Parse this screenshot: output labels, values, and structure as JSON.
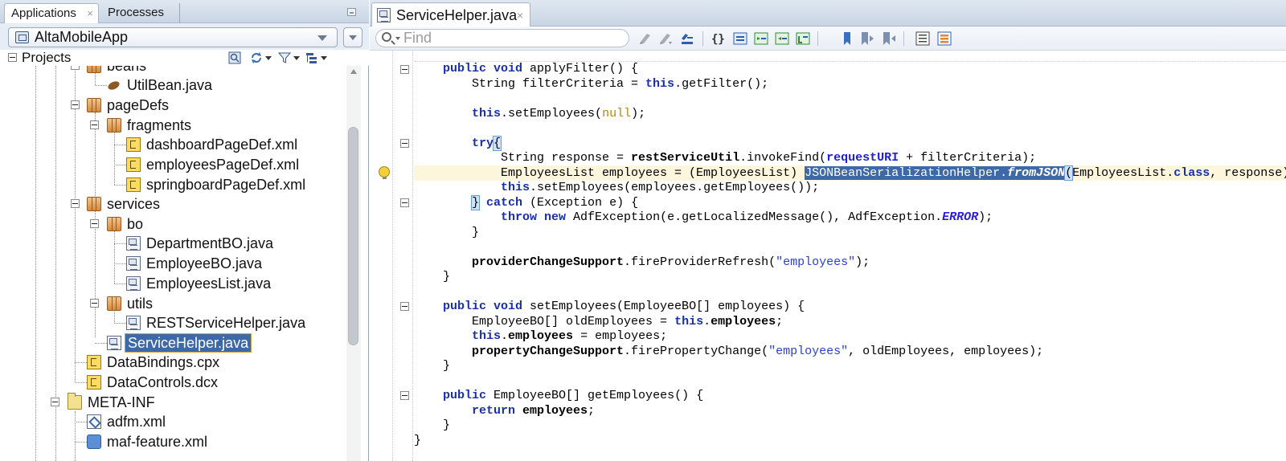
{
  "left_panel": {
    "tabs": [
      {
        "label": "Applications",
        "close": "×"
      },
      {
        "label": "Processes"
      }
    ],
    "application": {
      "selected": "AltaMobileApp"
    },
    "projects": {
      "label": "Projects"
    },
    "tree": [
      {
        "label": "beans"
      },
      {
        "label": "UtilBean.java"
      },
      {
        "label": "pageDefs"
      },
      {
        "label": "fragments"
      },
      {
        "label": "dashboardPageDef.xml"
      },
      {
        "label": "employeesPageDef.xml"
      },
      {
        "label": "springboardPageDef.xml"
      },
      {
        "label": "services"
      },
      {
        "label": "bo"
      },
      {
        "label": "DepartmentBO.java"
      },
      {
        "label": "EmployeeBO.java"
      },
      {
        "label": "EmployeesList.java"
      },
      {
        "label": "utils"
      },
      {
        "label": "RESTServiceHelper.java"
      },
      {
        "label": "ServiceHelper.java"
      },
      {
        "label": "DataBindings.cpx"
      },
      {
        "label": "DataControls.dcx"
      },
      {
        "label": "META-INF"
      },
      {
        "label": "adfm.xml"
      },
      {
        "label": "maf-feature.xml"
      }
    ]
  },
  "editor": {
    "tab": {
      "label": "ServiceHelper.java",
      "close": "×"
    },
    "find": {
      "placeholder": "Find",
      "value": ""
    },
    "code": [
      [
        [
          "kw",
          "    public void "
        ],
        [
          "",
          "applyFilter() {"
        ]
      ],
      [
        [
          "",
          "        String filterCriteria = "
        ],
        [
          "kw",
          "this"
        ],
        [
          "",
          ".getFilter();"
        ]
      ],
      [
        [
          "",
          ""
        ]
      ],
      [
        [
          "",
          "        "
        ],
        [
          "kw",
          "this"
        ],
        [
          "",
          ".setEmployees("
        ],
        [
          "nl",
          "null"
        ],
        [
          "",
          ");"
        ]
      ],
      [
        [
          "",
          ""
        ]
      ],
      [
        [
          "",
          "        "
        ],
        [
          "kw",
          "try"
        ],
        [
          "br",
          "{"
        ]
      ],
      [
        [
          "",
          "            String response = "
        ],
        [
          "fl",
          "restServiceUtil"
        ],
        [
          "",
          ".invokeFind("
        ],
        [
          "ffl",
          "requestURI"
        ],
        [
          "",
          " + filterCriteria);"
        ]
      ],
      [
        [
          "",
          "            EmployeesList employees = (EmployeesList) "
        ],
        [
          "sel",
          "JSONBeanSerializationHelper."
        ],
        [
          "selit",
          "fromJSON"
        ],
        [
          "br",
          "("
        ],
        [
          "",
          "EmployeesList."
        ],
        [
          "kw",
          "class"
        ],
        [
          "",
          ", response)"
        ],
        [
          "caret",
          ";"
        ]
      ],
      [
        [
          "",
          "            "
        ],
        [
          "kw",
          "this"
        ],
        [
          "",
          ".setEmployees(employees.getEmployees());"
        ]
      ],
      [
        [
          "",
          "        "
        ],
        [
          "br",
          "}"
        ],
        [
          "kw",
          " catch "
        ],
        [
          "",
          "(Exception e) {"
        ]
      ],
      [
        [
          "",
          "            "
        ],
        [
          "kw",
          "throw new "
        ],
        [
          "",
          "AdfException(e.getLocalizedMessage(), AdfException."
        ],
        [
          "it",
          "ERROR"
        ],
        [
          "",
          ");"
        ]
      ],
      [
        [
          "",
          "        }"
        ]
      ],
      [
        [
          "",
          ""
        ]
      ],
      [
        [
          "",
          "        "
        ],
        [
          "fl",
          "providerChangeSupport"
        ],
        [
          "",
          ".fireProviderRefresh("
        ],
        [
          "st",
          "\"employees\""
        ],
        [
          "",
          ");"
        ]
      ],
      [
        [
          "",
          "    }"
        ]
      ],
      [
        [
          "",
          ""
        ]
      ],
      [
        [
          "kw",
          "    public void "
        ],
        [
          "",
          "setEmployees(EmployeeBO[] employees) {"
        ]
      ],
      [
        [
          "",
          "        EmployeeBO[] oldEmployees = "
        ],
        [
          "kw",
          "this"
        ],
        [
          "",
          "."
        ],
        [
          "fl",
          "employees"
        ],
        [
          "",
          ";"
        ]
      ],
      [
        [
          "",
          "        "
        ],
        [
          "kw",
          "this"
        ],
        [
          "",
          "."
        ],
        [
          "fl",
          "employees"
        ],
        [
          "",
          " = employees;"
        ]
      ],
      [
        [
          "",
          "        "
        ],
        [
          "fl",
          "propertyChangeSupport"
        ],
        [
          "",
          ".firePropertyChange("
        ],
        [
          "st",
          "\"employees\""
        ],
        [
          "",
          ", oldEmployees, employees);"
        ]
      ],
      [
        [
          "",
          "    }"
        ]
      ],
      [
        [
          "",
          ""
        ]
      ],
      [
        [
          "kw",
          "    public "
        ],
        [
          "",
          "EmployeeBO[] getEmployees() {"
        ]
      ],
      [
        [
          "",
          "        "
        ],
        [
          "kw",
          "return "
        ],
        [
          "fl",
          "employees"
        ],
        [
          "",
          ";"
        ]
      ],
      [
        [
          "",
          "    }"
        ]
      ],
      [
        [
          "",
          "}"
        ]
      ]
    ]
  },
  "colors": {
    "accent": "#3d69a8",
    "keyword": "#1a30a8",
    "string": "#2a3fd3",
    "null_literal": "#b8860b",
    "current_line": "#fdf5dc"
  },
  "icons": {
    "package": "package-icon",
    "java_file": "java-file-icon",
    "xml_file": "xml-file-icon",
    "bean_file": "bean-icon",
    "folder": "folder-icon",
    "hint": "lightbulb-icon"
  }
}
